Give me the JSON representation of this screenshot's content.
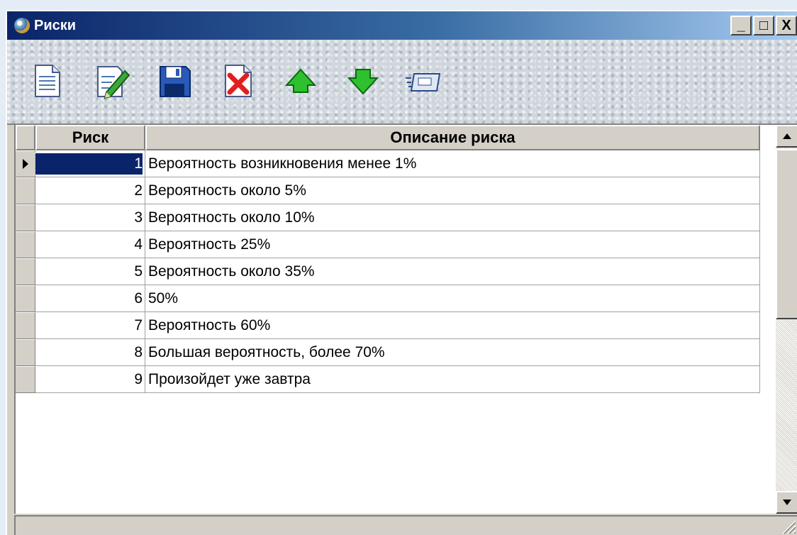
{
  "window": {
    "title": "Риски",
    "controls": {
      "minimize": "_",
      "maximize": "□",
      "close": "X"
    }
  },
  "toolbar": {
    "buttons": [
      {
        "name": "new-document-icon"
      },
      {
        "name": "edit-pencil-icon"
      },
      {
        "name": "save-floppy-icon"
      },
      {
        "name": "delete-document-icon"
      },
      {
        "name": "arrow-up-icon"
      },
      {
        "name": "arrow-down-icon"
      },
      {
        "name": "export-card-icon"
      }
    ]
  },
  "grid": {
    "columns": [
      "Риск",
      "Описание риска"
    ],
    "selected_row": 0,
    "rows": [
      {
        "risk": "1",
        "description": "Вероятность возникновения менее 1%"
      },
      {
        "risk": "2",
        "description": "Вероятность около 5%"
      },
      {
        "risk": "3",
        "description": "Вероятность около 10%"
      },
      {
        "risk": "4",
        "description": "Вероятность 25%"
      },
      {
        "risk": "5",
        "description": "Вероятность около 35%"
      },
      {
        "risk": "6",
        "description": "50%"
      },
      {
        "risk": "7",
        "description": "Вероятность 60%"
      },
      {
        "risk": "8",
        "description": "Большая вероятность, более 70%"
      },
      {
        "risk": "9",
        "description": "Произойдет уже завтра"
      }
    ]
  },
  "colors": {
    "title_gradient_start": "#0a246a",
    "title_gradient_end": "#a6caf0",
    "selection": "#0a246a",
    "face": "#d4d0c8"
  }
}
